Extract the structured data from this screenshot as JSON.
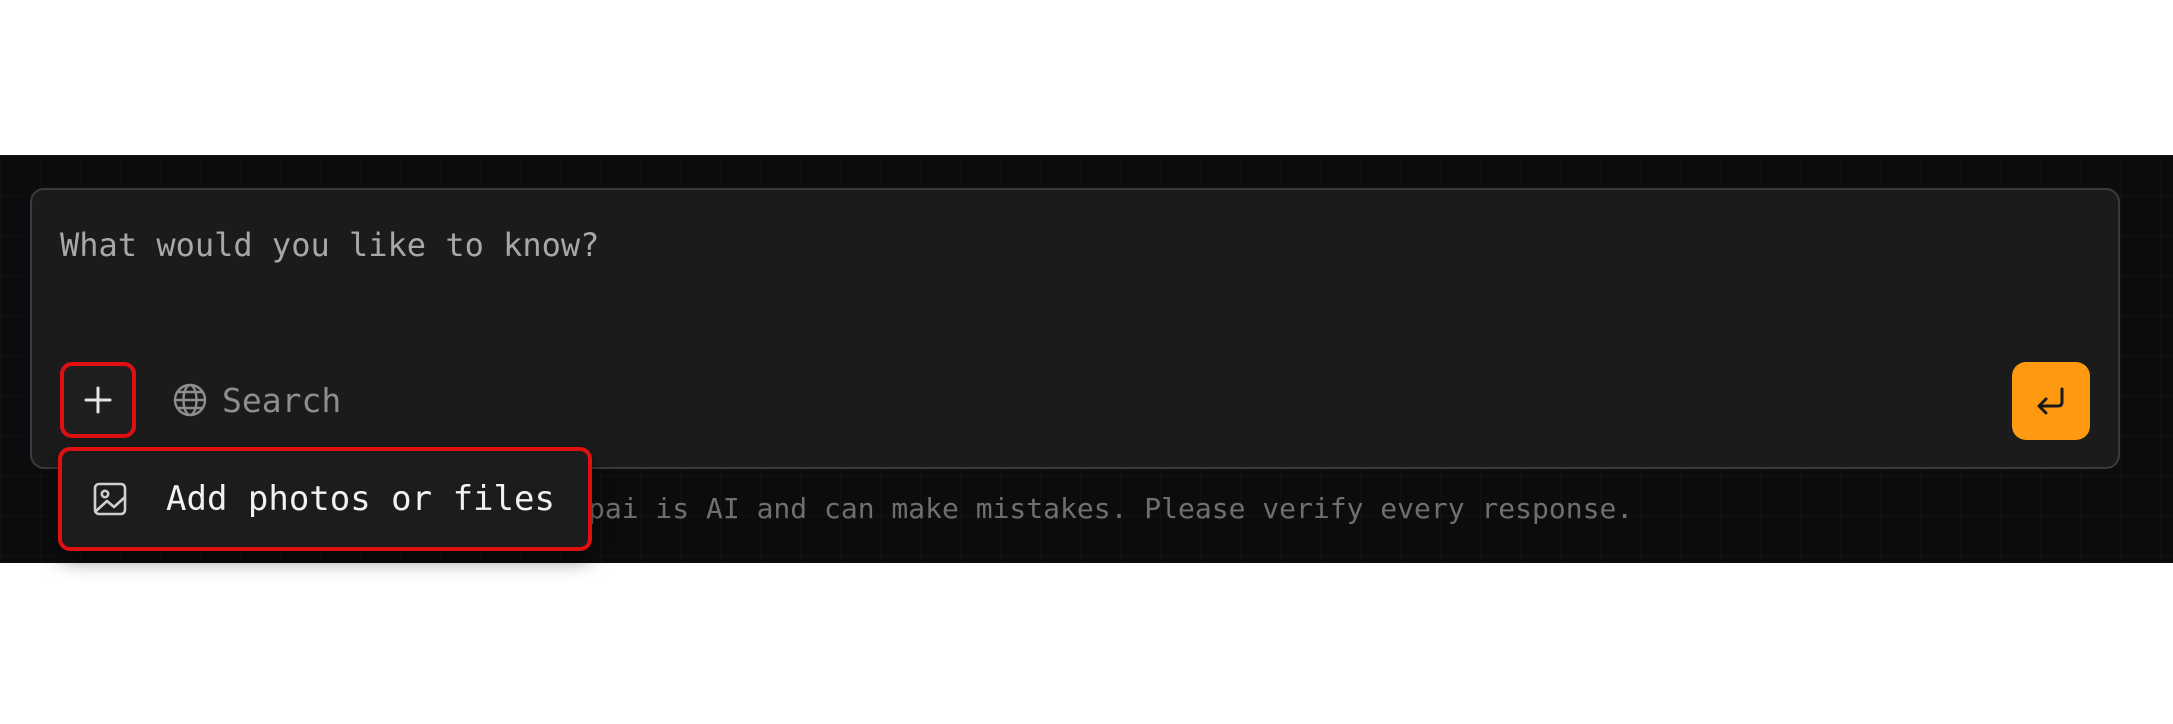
{
  "composer": {
    "placeholder": "What would you like to know?",
    "search_label": "Search",
    "disclaimer": "pai is AI and can make mistakes. Please verify every response."
  },
  "attach_menu": {
    "items": [
      {
        "label": "Add photos or files",
        "icon": "image-icon"
      }
    ]
  },
  "icons": {
    "plus": "plus-icon",
    "search": "globe-icon",
    "send": "enter-return-icon"
  },
  "colors": {
    "background": "#0b0c0e",
    "composer": "#1b1b1c",
    "accent": "#ff9a10",
    "highlight": "#e01010"
  }
}
